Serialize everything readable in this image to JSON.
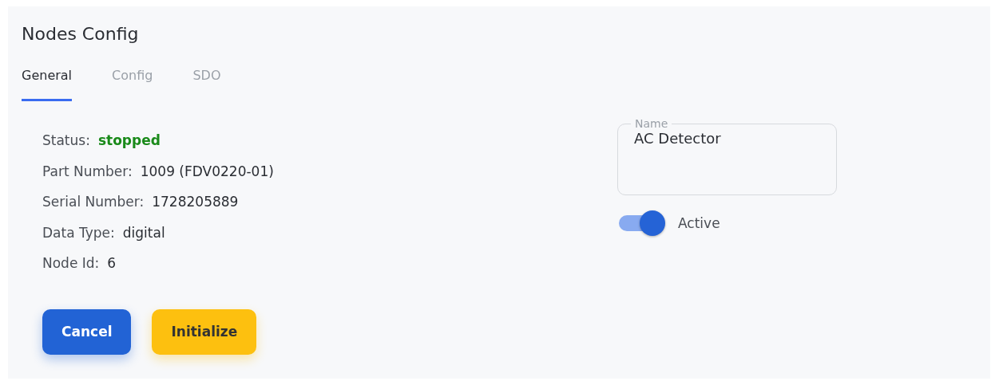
{
  "title": "Nodes Config",
  "tabs": [
    {
      "label": "General",
      "selected": true
    },
    {
      "label": "Config",
      "selected": false
    },
    {
      "label": "SDO",
      "selected": false
    }
  ],
  "details": [
    {
      "label": "Status:",
      "value": "stopped",
      "kind": "status"
    },
    {
      "label": "Part Number:",
      "value": "1009 (FDV0220-01)",
      "kind": "plain"
    },
    {
      "label": "Serial Number:",
      "value": "1728205889",
      "kind": "plain"
    },
    {
      "label": "Data Type:",
      "value": "digital",
      "kind": "plain"
    },
    {
      "label": "Node Id:",
      "value": "6",
      "kind": "plain"
    }
  ],
  "name_field": {
    "label": "Name",
    "value": "AC Detector"
  },
  "active_toggle": {
    "label": "Active",
    "on": true
  },
  "buttons": [
    {
      "label": "Cancel",
      "kind": "primary"
    },
    {
      "label": "Initialize",
      "kind": "warning"
    }
  ]
}
